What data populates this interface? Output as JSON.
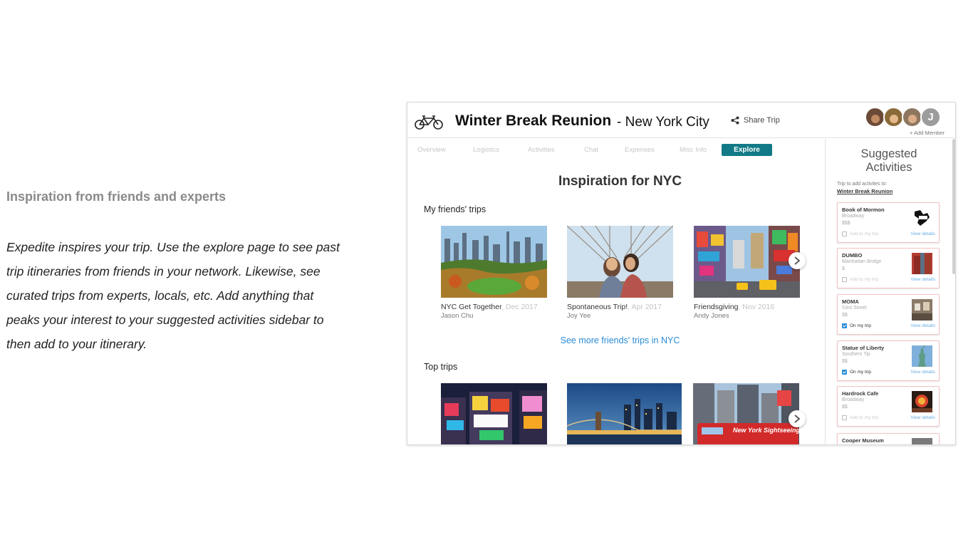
{
  "description": {
    "heading": "Inspiration from friends and experts",
    "body": "Expedite inspires your trip. Use the explore page to see past trip itineraries from friends in your network. Likewise, see curated trips from experts, locals, etc. Add anything that peaks your interest to your suggested activities sidebar to then add to your itinerary."
  },
  "header": {
    "logo_icon": "tandem-bicycle-icon",
    "trip_title": "Winter Break Reunion",
    "trip_city": "- New York City",
    "share_label": "Share Trip",
    "share_icon": "share-icon",
    "member_initial": "J",
    "add_member_label": "+ Add Member"
  },
  "tabs": [
    "Overview",
    "Logistics",
    "Activities",
    "Chat",
    "Expenses",
    "Misc Info"
  ],
  "active_tab": "Explore",
  "explore": {
    "heading": "Inspiration for NYC",
    "friends_section": "My friends' trips",
    "friend_trips": [
      {
        "title": "NYC Get Together",
        "date": ", Dec 2017",
        "author": "Jason Chu"
      },
      {
        "title": "Spontaneous Trip!",
        "date": ", Apr 2017",
        "author": "Joy Yee"
      },
      {
        "title": "Friendsgiving",
        "date": ", Nov 2016",
        "author": "Andy Jones"
      }
    ],
    "see_more": "See more friends' trips in NYC",
    "top_section": "Top trips",
    "top_bus_text": "New York Sightseeing"
  },
  "sidebar": {
    "heading_line1": "Suggested",
    "heading_line2": "Activities",
    "hint": "Trip to add activites to:",
    "trip_link": "Winter Break Reunion",
    "add_label": "Add to my trip",
    "on_label": "On my trip",
    "view_label": "View details",
    "activities": [
      {
        "name": "Book of Mormon",
        "location": "Broadway",
        "price": "$$$",
        "on_trip": false
      },
      {
        "name": "DUMBO",
        "location": "Manhattan Bridge",
        "price": "$",
        "on_trip": false
      },
      {
        "name": "MOMA",
        "location": "53rd Street",
        "price": "$$",
        "on_trip": true
      },
      {
        "name": "Statue of Liberty",
        "location": "Southern Tip",
        "price": "$$",
        "on_trip": true
      },
      {
        "name": "Hardrock Cafe",
        "location": "Broadway",
        "price": "$$",
        "on_trip": false
      },
      {
        "name": "Cooper Museum"
      }
    ]
  },
  "colors": {
    "accent_teal": "#127a86",
    "link_blue": "#2a8cd6",
    "card_border_pink": "#f3c3c3"
  }
}
